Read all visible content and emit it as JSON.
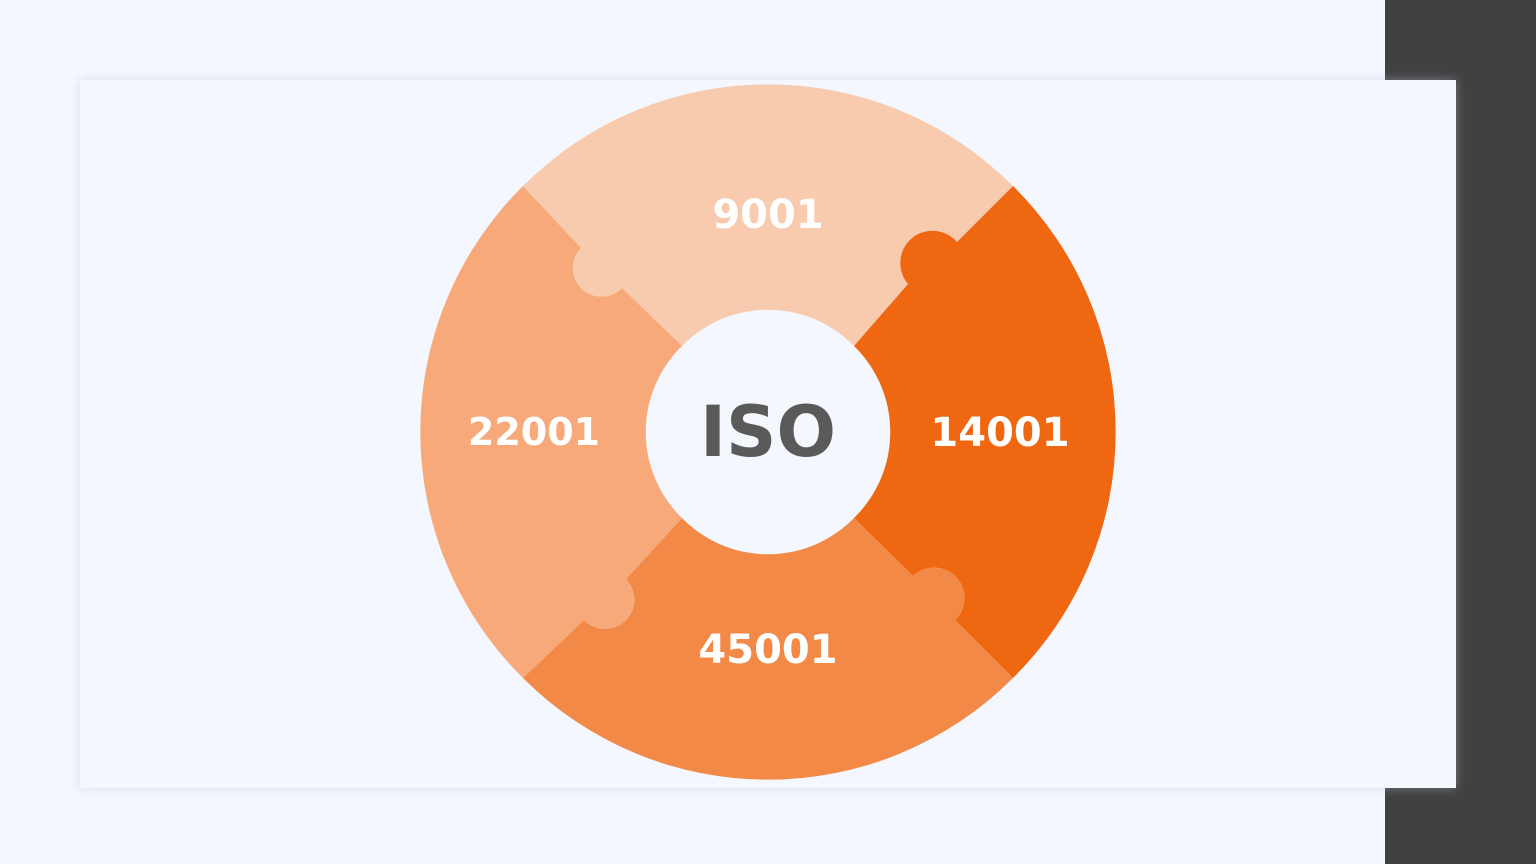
{
  "colors": {
    "background": "#f4f7fd",
    "side_bar": "#414141",
    "piece_top": "#f9cbae",
    "piece_left": "#f7a97a",
    "piece_bottom": "#f38947",
    "piece_right": "#f06711",
    "piece_label": "#ffffff",
    "center_fill": "#f4f7fd",
    "center_text": "#5a5a5a"
  },
  "diagram": {
    "center_label": "ISO",
    "pieces": {
      "top": "9001",
      "right": "14001",
      "bottom": "45001",
      "left": "22001"
    }
  }
}
